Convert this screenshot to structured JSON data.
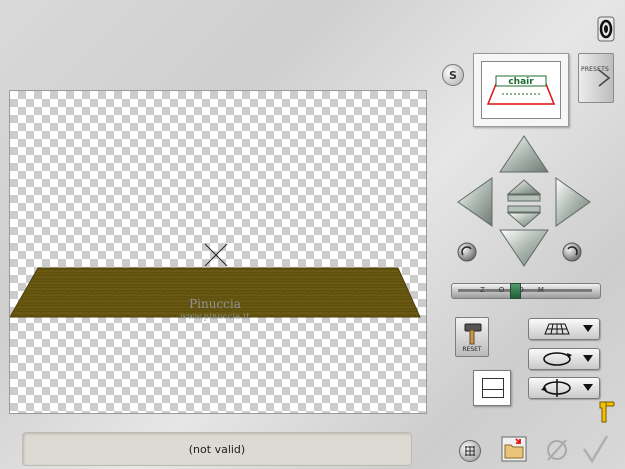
{
  "status": {
    "text": "(not valid)"
  },
  "watermark": {
    "name": "Pinuccia",
    "site": "www.pinuccia.it"
  },
  "preview": {
    "background": "transparent-checkerboard",
    "floor_color": "#6b5a12",
    "center_marker": "x-cross"
  },
  "thumbnail": {
    "logo_text": "chair"
  },
  "presets": {
    "label": "PRESETS"
  },
  "s_button": {
    "label": "S"
  },
  "reset": {
    "label": "RESET"
  },
  "zoom": {
    "label": "ZOOM",
    "level": 0.42
  },
  "navigation": {
    "icons": [
      "arrow-up-icon",
      "arrow-down-icon",
      "arrow-left-icon",
      "arrow-right-icon",
      "move-up-small-icon",
      "move-down-small-icon",
      "rotate-left-icon",
      "rotate-right-icon"
    ]
  },
  "dropdowns": [
    {
      "icon": "grid-perspective-icon"
    },
    {
      "icon": "rotate-ring-icon"
    },
    {
      "icon": "rotate-axis-icon"
    }
  ],
  "colors": {
    "accent": "#3f7d56",
    "panel": "#d6d6d6",
    "status_bg": "#dcdad2"
  }
}
